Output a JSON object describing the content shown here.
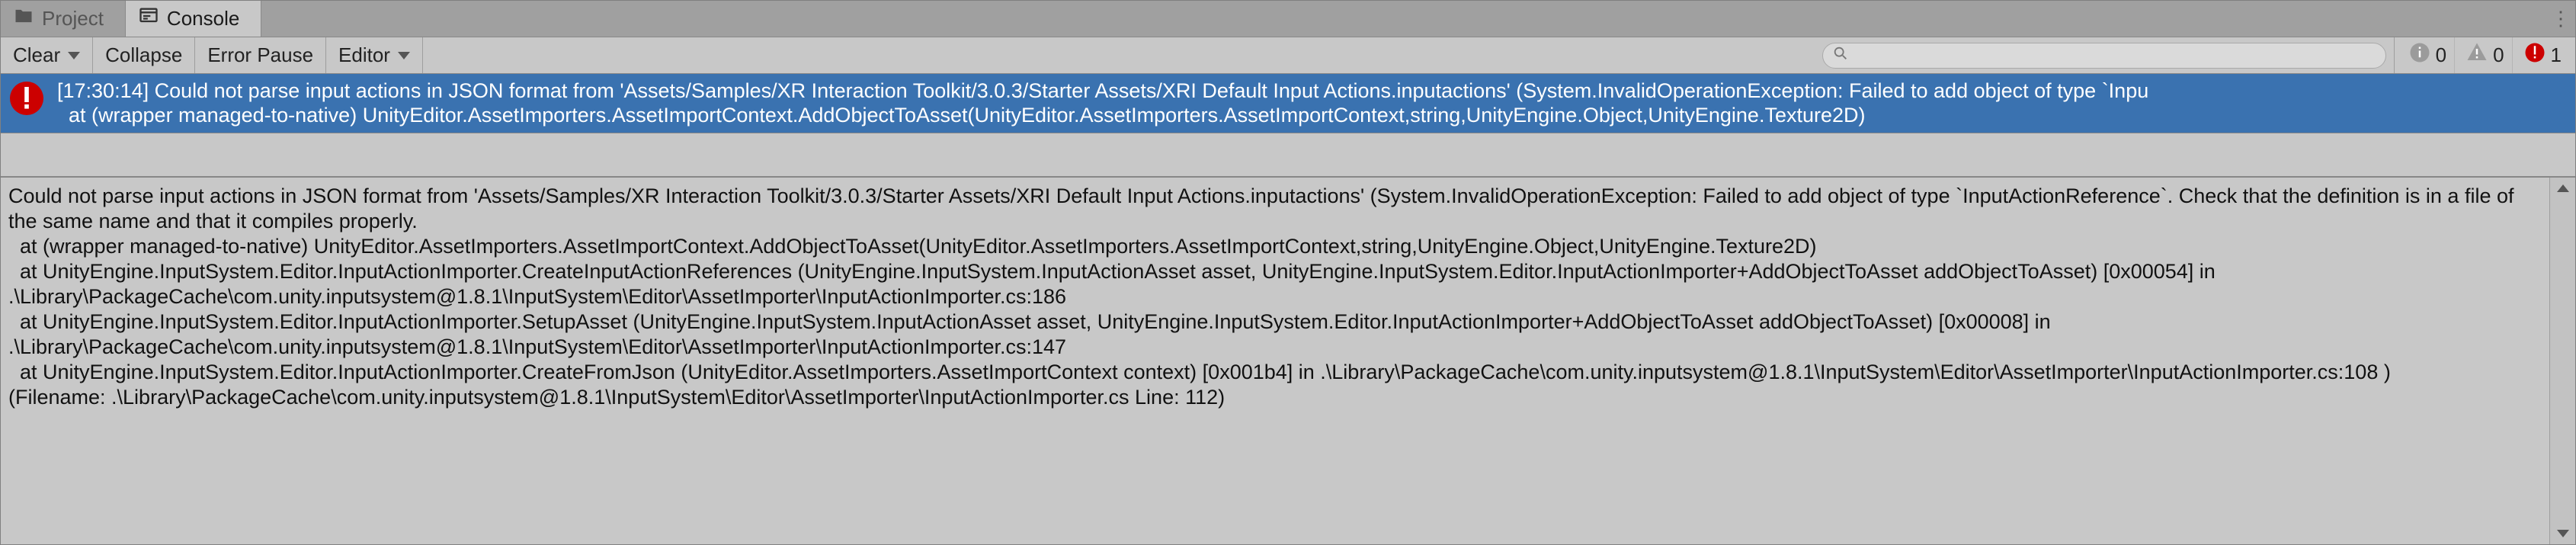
{
  "tabs": {
    "project": "Project",
    "console": "Console"
  },
  "toolbar": {
    "clear": "Clear",
    "collapse": "Collapse",
    "errorPause": "Error Pause",
    "editor": "Editor"
  },
  "search": {
    "placeholder": ""
  },
  "counts": {
    "info": "0",
    "warn": "0",
    "error": "1"
  },
  "colors": {
    "selection": "#3A72B0",
    "error": "#CC0000",
    "warn": "#9B9B9B",
    "info": "#9B9B9B"
  },
  "logEntry": {
    "line1": "[17:30:14] Could not parse input actions in JSON format from 'Assets/Samples/XR Interaction Toolkit/3.0.3/Starter Assets/XRI Default Input Actions.inputactions' (System.InvalidOperationException: Failed to add object of type `Inpu",
    "line2": "  at (wrapper managed-to-native) UnityEditor.AssetImporters.AssetImportContext.AddObjectToAsset(UnityEditor.AssetImporters.AssetImportContext,string,UnityEngine.Object,UnityEngine.Texture2D)"
  },
  "detail": "Could not parse input actions in JSON format from 'Assets/Samples/XR Interaction Toolkit/3.0.3/Starter Assets/XRI Default Input Actions.inputactions' (System.InvalidOperationException: Failed to add object of type `InputActionReference`. Check that the definition is in a file of the same name and that it compiles properly.\n  at (wrapper managed-to-native) UnityEditor.AssetImporters.AssetImportContext.AddObjectToAsset(UnityEditor.AssetImporters.AssetImportContext,string,UnityEngine.Object,UnityEngine.Texture2D)\n  at UnityEngine.InputSystem.Editor.InputActionImporter.CreateInputActionReferences (UnityEngine.InputSystem.InputActionAsset asset, UnityEngine.InputSystem.Editor.InputActionImporter+AddObjectToAsset addObjectToAsset) [0x00054] in .\\Library\\PackageCache\\com.unity.inputsystem@1.8.1\\InputSystem\\Editor\\AssetImporter\\InputActionImporter.cs:186\n  at UnityEngine.InputSystem.Editor.InputActionImporter.SetupAsset (UnityEngine.InputSystem.InputActionAsset asset, UnityEngine.InputSystem.Editor.InputActionImporter+AddObjectToAsset addObjectToAsset) [0x00008] in .\\Library\\PackageCache\\com.unity.inputsystem@1.8.1\\InputSystem\\Editor\\AssetImporter\\InputActionImporter.cs:147\n  at UnityEngine.InputSystem.Editor.InputActionImporter.CreateFromJson (UnityEditor.AssetImporters.AssetImportContext context) [0x001b4] in .\\Library\\PackageCache\\com.unity.inputsystem@1.8.1\\InputSystem\\Editor\\AssetImporter\\InputActionImporter.cs:108 )\n(Filename: .\\Library\\PackageCache\\com.unity.inputsystem@1.8.1\\InputSystem\\Editor\\AssetImporter\\InputActionImporter.cs Line: 112)"
}
